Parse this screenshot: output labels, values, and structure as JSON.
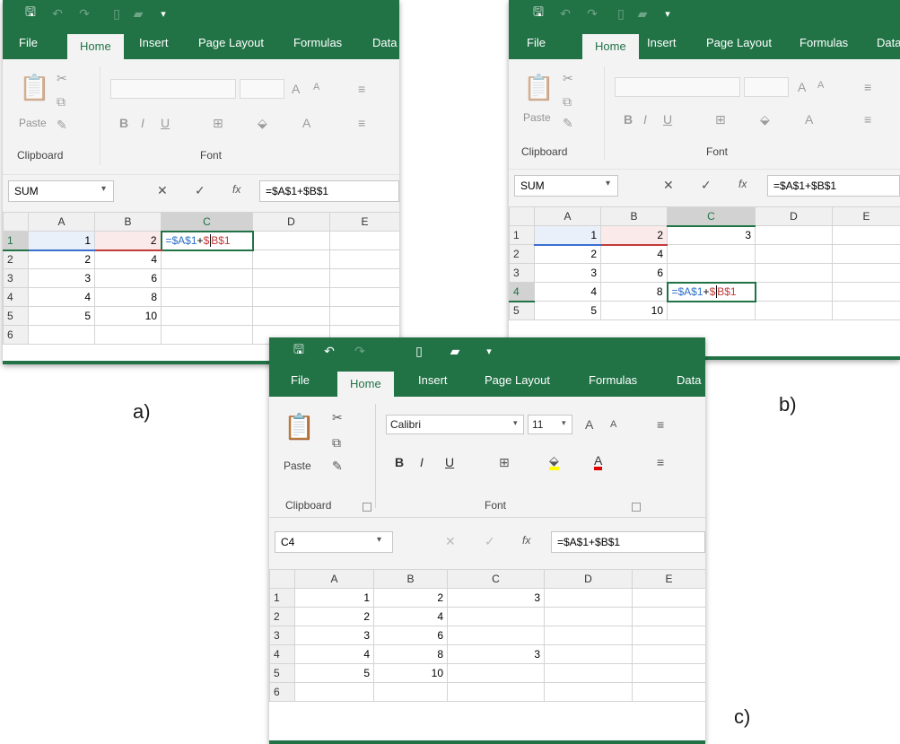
{
  "ribbon": {
    "tabs": [
      "File",
      "Home",
      "Insert",
      "Page Layout",
      "Formulas",
      "Data"
    ],
    "groups": {
      "clipboard": "Clipboard",
      "font": "Font"
    },
    "paste_label": "Paste",
    "font_name": "Calibri",
    "font_size": "11",
    "bold": "B",
    "italic": "I",
    "underline": "U",
    "grow_font": "A",
    "shrink_font": "A",
    "font_color": "A"
  },
  "fx_label": "fx",
  "columns": [
    "A",
    "B",
    "C",
    "D",
    "E"
  ],
  "captions": {
    "a": "a)",
    "b": "b)",
    "c": "c)"
  },
  "panels": {
    "a": {
      "name_box": "SUM",
      "formula": "=$A$1+$B$1",
      "rows": [
        {
          "n": "1",
          "A": "1",
          "B": "2",
          "C": ""
        },
        {
          "n": "2",
          "A": "2",
          "B": "4",
          "C": ""
        },
        {
          "n": "3",
          "A": "3",
          "B": "6",
          "C": ""
        },
        {
          "n": "4",
          "A": "4",
          "B": "8",
          "C": ""
        },
        {
          "n": "5",
          "A": "5",
          "B": "10",
          "C": ""
        },
        {
          "n": "6",
          "A": "",
          "B": "",
          "C": ""
        }
      ],
      "edit_ref_a": "=$A$1",
      "edit_plus": "+",
      "edit_dollar": "$",
      "edit_ref_b": "B$1"
    },
    "b": {
      "name_box": "SUM",
      "formula": "=$A$1+$B$1",
      "rows": [
        {
          "n": "1",
          "A": "1",
          "B": "2",
          "C": "3"
        },
        {
          "n": "2",
          "A": "2",
          "B": "4",
          "C": ""
        },
        {
          "n": "3",
          "A": "3",
          "B": "6",
          "C": ""
        },
        {
          "n": "4",
          "A": "4",
          "B": "8",
          "C": ""
        },
        {
          "n": "5",
          "A": "5",
          "B": "10",
          "C": ""
        }
      ],
      "edit_ref_a": "=$A$1",
      "edit_plus": "+",
      "edit_dollar": "$",
      "edit_ref_b": "B$1"
    },
    "c": {
      "name_box": "C4",
      "formula": "=$A$1+$B$1",
      "rows": [
        {
          "n": "1",
          "A": "1",
          "B": "2",
          "C": "3"
        },
        {
          "n": "2",
          "A": "2",
          "B": "4",
          "C": ""
        },
        {
          "n": "3",
          "A": "3",
          "B": "6",
          "C": ""
        },
        {
          "n": "4",
          "A": "4",
          "B": "8",
          "C": "3"
        },
        {
          "n": "5",
          "A": "5",
          "B": "10",
          "C": ""
        },
        {
          "n": "6",
          "A": "",
          "B": "",
          "C": ""
        }
      ]
    }
  },
  "colors": {
    "excel_green": "#217346",
    "ref_blue": "#2e6fc7",
    "ref_red": "#c23a3a"
  }
}
